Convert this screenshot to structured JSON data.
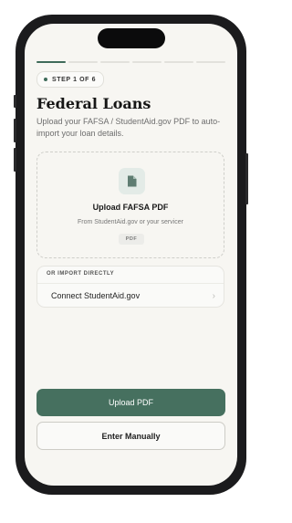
{
  "progress": {
    "total_steps": 6,
    "current_step": 1
  },
  "header": {
    "step_label": "STEP 1 OF 6",
    "title": "Federal Loans",
    "subtitle": "Upload your FAFSA / StudentAid.gov PDF to auto-import your loan details."
  },
  "upload_card": {
    "icon": "document-icon",
    "title": "Upload FAFSA PDF",
    "subtitle": "From StudentAid.gov or your servicer",
    "file_type_tag": "PDF"
  },
  "import": {
    "section_label": "OR IMPORT DIRECTLY",
    "options": [
      {
        "label": "Connect StudentAid.gov",
        "icon": "chevron-right-icon"
      }
    ]
  },
  "actions": {
    "primary_label": "Upload PDF",
    "secondary_label": "Enter Manually"
  },
  "colors": {
    "accent": "#46705f",
    "background": "#f7f6f2",
    "text": "#161616"
  }
}
